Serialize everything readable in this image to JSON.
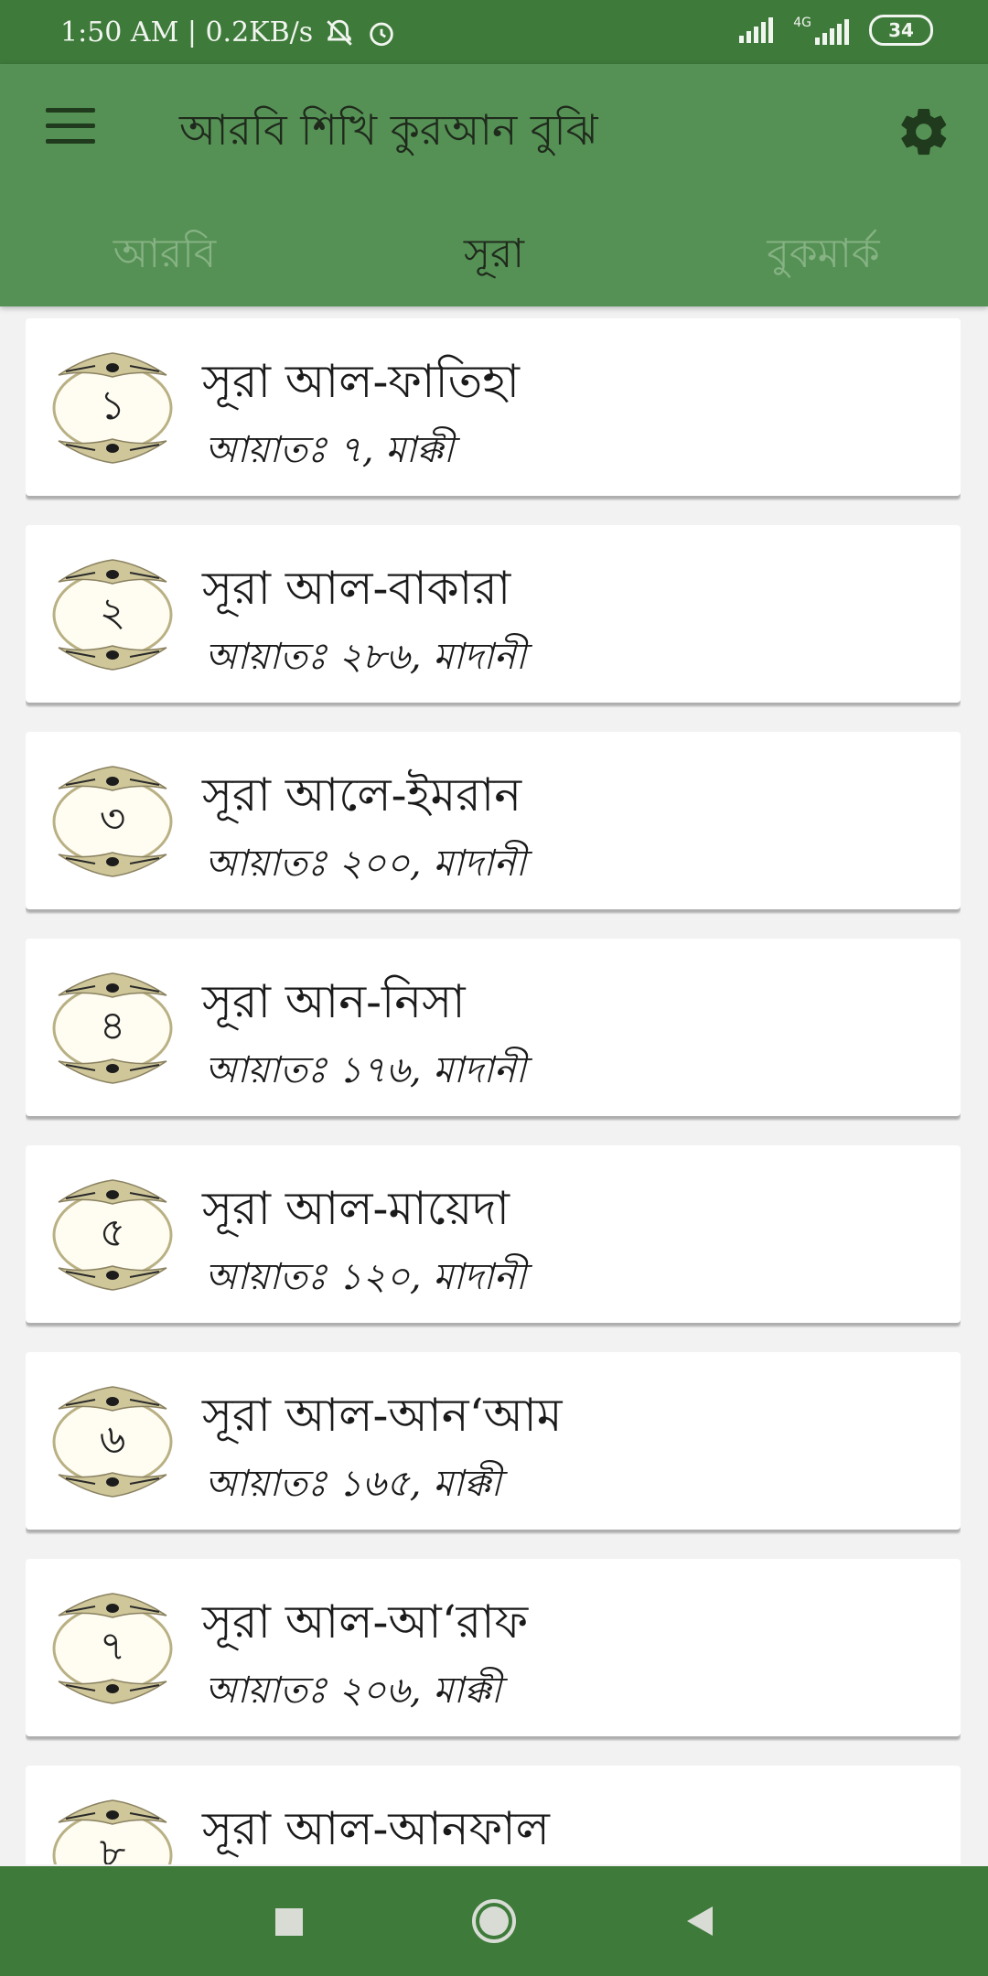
{
  "status_bar": {
    "time": "1:50 AM | 0.2KB/s",
    "network": "4G",
    "battery": "34"
  },
  "app_bar": {
    "title": "আরবি শিখি কুরআন বুঝি"
  },
  "tabs": [
    {
      "label": "আরবি",
      "active": false
    },
    {
      "label": "সূরা",
      "active": true
    },
    {
      "label": "বুকমার্ক",
      "active": false
    }
  ],
  "surahs": [
    {
      "number": "১",
      "name": "সূরা আল-ফাতিহা",
      "info": "আয়াতঃ ৭, মাক্কী"
    },
    {
      "number": "২",
      "name": "সূরা আল-বাকারা",
      "info": "আয়াতঃ ২৮৬, মাদানী"
    },
    {
      "number": "৩",
      "name": "সূরা আলে-ইমরান",
      "info": "আয়াতঃ ২০০, মাদানী"
    },
    {
      "number": "৪",
      "name": "সূরা আন-নিসা",
      "info": "আয়াতঃ ১৭৬, মাদানী"
    },
    {
      "number": "৫",
      "name": "সূরা আল-মায়েদা",
      "info": "আয়াতঃ ১২০, মাদানী"
    },
    {
      "number": "৬",
      "name": "সূরা আল-আন‘আম",
      "info": "আয়াতঃ ১৬৫, মাক্কী"
    },
    {
      "number": "৭",
      "name": "সূরা আল-আ‘রাফ",
      "info": "আয়াতঃ ২০৬, মাক্কী"
    },
    {
      "number": "৮",
      "name": "সূরা আল-আনফাল",
      "info": ""
    }
  ],
  "colors": {
    "status_bar": "#3e7a3a",
    "app_bar": "#559154",
    "nav_bar": "#3e7a3a",
    "active_tab": "#1f2a1d",
    "inactive_tab": "#86b284"
  },
  "icons": {
    "menu": "menu-icon",
    "settings": "gear-icon",
    "mute": "bell-off-icon",
    "alarm": "alarm-icon",
    "nav_recent": "square-icon",
    "nav_home": "circle-icon",
    "nav_back": "triangle-back-icon"
  }
}
